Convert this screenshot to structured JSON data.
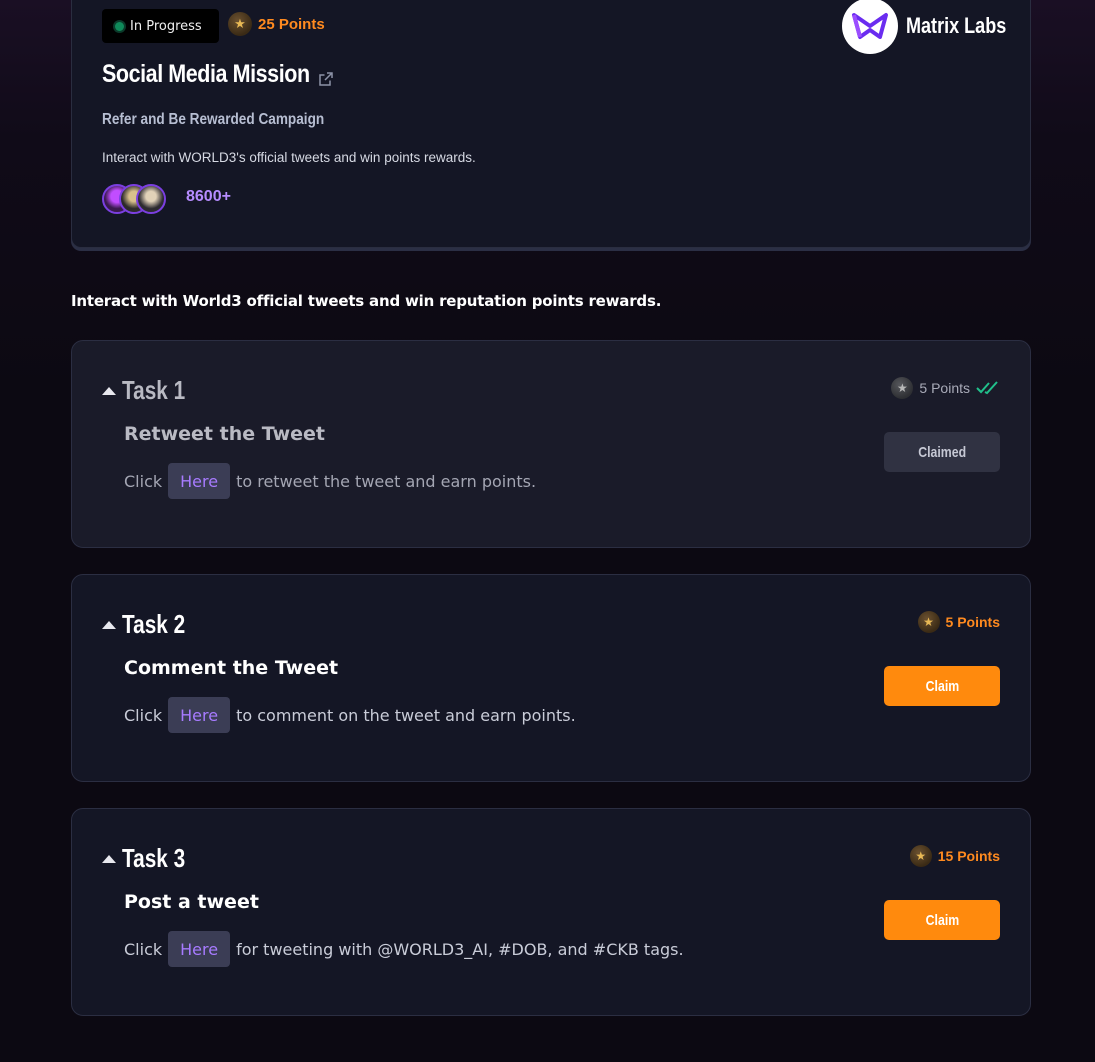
{
  "mission": {
    "status": "In Progress",
    "points": "25 Points",
    "title": "Social Media Mission",
    "subtitle": "Refer and Be Rewarded Campaign",
    "description": "Interact with WORLD3's official tweets and win points rewards.",
    "participants": "8600+",
    "brand": "Matrix Labs"
  },
  "section_heading": "Interact with World3 official tweets and win reputation points rewards.",
  "tasks": [
    {
      "label": "Task 1",
      "title": "Retweet the Tweet",
      "prefix": "Click",
      "link": "Here",
      "suffix": "to retweet the tweet and earn points.",
      "points": "5 Points",
      "button": "Claimed"
    },
    {
      "label": "Task 2",
      "title": "Comment the Tweet",
      "prefix": "Click",
      "link": "Here",
      "suffix": "to comment on the tweet and earn points.",
      "points": "5 Points",
      "button": "Claim"
    },
    {
      "label": "Task 3",
      "title": "Post a tweet",
      "prefix": "Click",
      "link": "Here",
      "suffix": "for tweeting with @WORLD3_AI, #DOB, and #CKB tags.",
      "points": "15 Points",
      "button": "Claim"
    }
  ],
  "colors": {
    "accent": "#ff8a0d",
    "link": "#a77bff",
    "card": "#141625",
    "status_dot": "#0f8a5a"
  },
  "icons": [
    "star-coin-icon",
    "external-link-icon",
    "double-check-icon",
    "caret-up-icon",
    "matrix-labs-logo"
  ]
}
